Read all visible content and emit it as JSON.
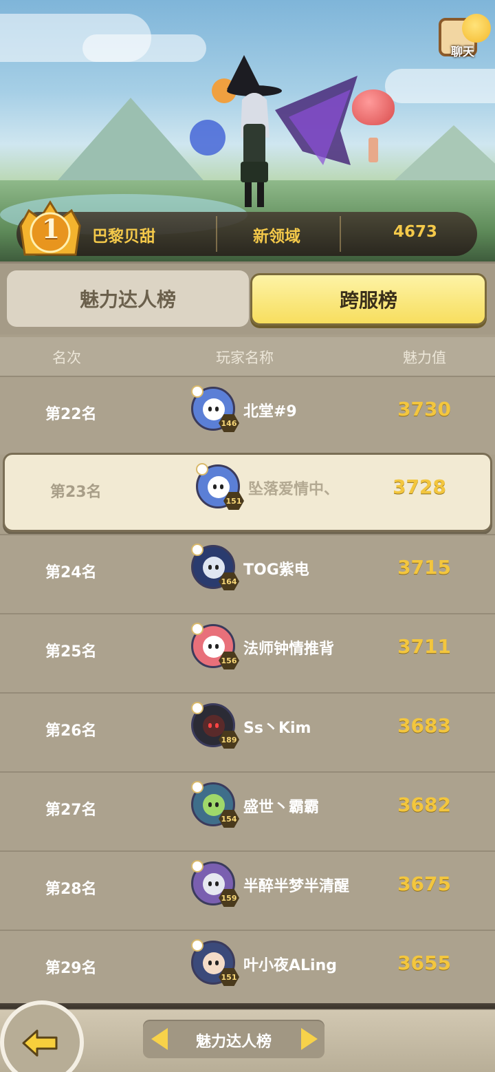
{
  "header": {
    "chat_label": "聊天",
    "top_rank": "1",
    "top_player": "巴黎贝甜",
    "top_server": "新领域",
    "top_score": "4673"
  },
  "tabs": [
    {
      "label": "魅力达人榜",
      "active": false
    },
    {
      "label": "跨服榜",
      "active": true
    }
  ],
  "table": {
    "columns": [
      "名次",
      "玩家名称",
      "魅力值"
    ],
    "rows": [
      {
        "rank": "第22名",
        "name": "北堂#9",
        "score": "3730",
        "level": "146",
        "avatar_color": "#5b7fd6",
        "highlight": false
      },
      {
        "rank": "第23名",
        "name": "坠落爱情中、",
        "score": "3728",
        "level": "151",
        "avatar_color": "#5b7fd6",
        "highlight": true
      },
      {
        "rank": "第24名",
        "name": "TOG紫电",
        "score": "3715",
        "level": "164",
        "avatar_color": "#2a3b6e",
        "highlight": false
      },
      {
        "rank": "第25名",
        "name": "法师钟情推背",
        "score": "3711",
        "level": "156",
        "avatar_color": "#e8707a",
        "highlight": false
      },
      {
        "rank": "第26名",
        "name": "Ss丶Kim",
        "score": "3683",
        "level": "189",
        "avatar_color": "#2b2b35",
        "highlight": false
      },
      {
        "rank": "第27名",
        "name": "盛世丶霸霸",
        "score": "3682",
        "level": "154",
        "avatar_color": "#3f6e8a",
        "highlight": false
      },
      {
        "rank": "第28名",
        "name": "半醉半梦半清醒",
        "score": "3675",
        "level": "159",
        "avatar_color": "#7a5fb0",
        "highlight": false
      },
      {
        "rank": "第29名",
        "name": "叶小夜ALing",
        "score": "3655",
        "level": "151",
        "avatar_color": "#3b4a7a",
        "highlight": false
      }
    ]
  },
  "footer": {
    "nav_label": "魅力达人榜"
  }
}
